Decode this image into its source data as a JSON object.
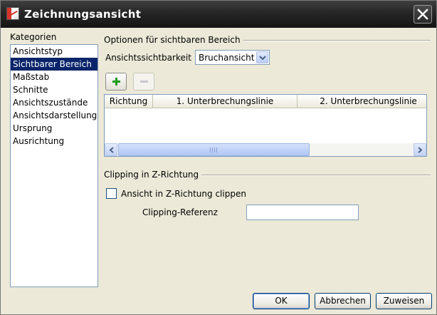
{
  "window": {
    "title": "Zeichnungsansicht"
  },
  "categories": {
    "label": "Kategorien",
    "items": [
      {
        "label": "Ansichtstyp",
        "selected": false
      },
      {
        "label": "Sichtbarer Bereich",
        "selected": true
      },
      {
        "label": "Maßstab",
        "selected": false
      },
      {
        "label": "Schnitte",
        "selected": false
      },
      {
        "label": "Ansichtszustände",
        "selected": false
      },
      {
        "label": "Ansichtsdarstellung",
        "selected": false
      },
      {
        "label": "Ursprung",
        "selected": false
      },
      {
        "label": "Ausrichtung",
        "selected": false
      }
    ]
  },
  "visible_area": {
    "group_title": "Optionen für sichtbaren Bereich",
    "visibility_label": "Ansichtssichtbarkeit",
    "visibility_value": "Bruchansicht",
    "table": {
      "columns": [
        "Richtung",
        "1. Unterbrechungslinie",
        "2. Unterbrechungslinie"
      ],
      "rows": []
    }
  },
  "clipping": {
    "group_title": "Clipping in Z-Richtung",
    "checkbox_label": "Ansicht in Z-Richtung clippen",
    "checked": false,
    "reference_label": "Clipping-Referenz",
    "reference_value": ""
  },
  "buttons": {
    "ok": "OK",
    "cancel": "Abbrechen",
    "apply": "Zuweisen"
  },
  "colors": {
    "selection": "#0a246a",
    "titlebar": "#262626",
    "add_icon": "#1e9b1e"
  }
}
